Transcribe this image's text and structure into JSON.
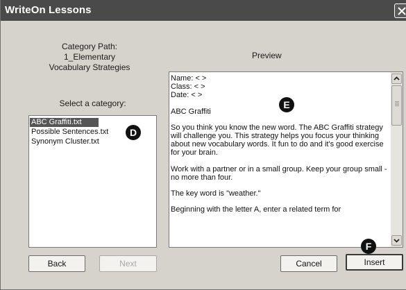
{
  "window": {
    "title": "WriteOn Lessons"
  },
  "category": {
    "path_label": "Category Path:",
    "path_lines": [
      "1_Elementary",
      "Vocabulary Strategies"
    ],
    "select_label": "Select a category:",
    "items": [
      {
        "label": "ABC Graffiti.txt",
        "selected": true
      },
      {
        "label": "Possible Sentences.txt",
        "selected": false
      },
      {
        "label": "Synonym Cluster.txt",
        "selected": false
      }
    ]
  },
  "preview": {
    "label": "Preview",
    "lines": [
      "Name: < >",
      "Class: < >",
      "Date: < >",
      "ABC Graffiti",
      "So you think you know the new word. The ABC Graffiti strategy will challenge you. This strategy helps you focus your thinking about new vocabulary words. It fun to do and it's good exercise for your brain.",
      "Work with a partner or in a small group. Keep your group small - no more than four.",
      "The key word is \"weather.\"",
      "Beginning with the letter A, enter a related term for"
    ]
  },
  "buttons": {
    "back": "Back",
    "next": "Next",
    "cancel": "Cancel",
    "insert": "Insert"
  },
  "callouts": {
    "d": "D",
    "e": "E",
    "f": "F"
  },
  "icons": {
    "close": "close-icon",
    "scroll_up": "arrow-up-icon",
    "scroll_down": "arrow-down-icon"
  },
  "colors": {
    "titlebar": "#4a4a4a",
    "dialog_bg": "#d6d3cc",
    "selection": "#555555",
    "callout": "#111111"
  }
}
